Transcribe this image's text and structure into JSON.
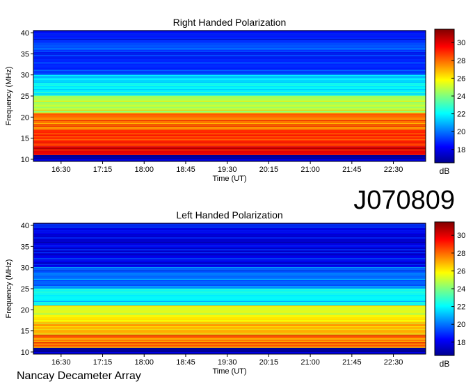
{
  "observation_id": "J070809",
  "footer_label": "Nancay Decameter Array",
  "chart_data": [
    {
      "type": "heatmap",
      "title": "Right Handed Polarization",
      "xlabel": "Time (UT)",
      "ylabel": "Frequency (MHz)",
      "x_ticks": [
        "16:30",
        "17:15",
        "18:00",
        "18:45",
        "19:30",
        "20:15",
        "21:00",
        "21:45",
        "22:30"
      ],
      "x_range": [
        "16:00",
        "23:05"
      ],
      "ylim": [
        9.5,
        40.5
      ],
      "y_ticks": [
        10,
        15,
        20,
        25,
        30,
        35,
        40
      ],
      "colorbar": {
        "label": "dB",
        "range": [
          16.5,
          31.5
        ],
        "ticks": [
          18,
          20,
          22,
          24,
          26,
          28,
          30
        ]
      },
      "intensity_bands": [
        {
          "freq_range_mhz": [
            10,
            11
          ],
          "db": 17
        },
        {
          "freq_range_mhz": [
            11,
            13
          ],
          "db": 30
        },
        {
          "freq_range_mhz": [
            13,
            17
          ],
          "db": 29
        },
        {
          "freq_range_mhz": [
            17,
            21
          ],
          "db": 28
        },
        {
          "freq_range_mhz": [
            21,
            25
          ],
          "db": 25
        },
        {
          "freq_range_mhz": [
            25,
            30
          ],
          "db": 22
        },
        {
          "freq_range_mhz": [
            30,
            40
          ],
          "db": 19
        }
      ]
    },
    {
      "type": "heatmap",
      "title": "Left Handed Polarization",
      "xlabel": "Time (UT)",
      "ylabel": "Frequency (MHz)",
      "x_ticks": [
        "16:30",
        "17:15",
        "18:00",
        "18:45",
        "19:30",
        "20:15",
        "21:00",
        "21:45",
        "22:30"
      ],
      "x_range": [
        "16:00",
        "23:05"
      ],
      "ylim": [
        9.5,
        40.5
      ],
      "y_ticks": [
        10,
        15,
        20,
        25,
        30,
        35,
        40
      ],
      "colorbar": {
        "label": "dB",
        "range": [
          16.5,
          31.5
        ],
        "ticks": [
          18,
          20,
          22,
          24,
          26,
          28,
          30
        ]
      },
      "intensity_bands": [
        {
          "freq_range_mhz": [
            10,
            11
          ],
          "db": 17
        },
        {
          "freq_range_mhz": [
            11,
            14
          ],
          "db": 28
        },
        {
          "freq_range_mhz": [
            14,
            17
          ],
          "db": 27
        },
        {
          "freq_range_mhz": [
            17,
            21
          ],
          "db": 26
        },
        {
          "freq_range_mhz": [
            21,
            25
          ],
          "db": 22
        },
        {
          "freq_range_mhz": [
            25,
            30
          ],
          "db": 20
        },
        {
          "freq_range_mhz": [
            30,
            40
          ],
          "db": 18
        }
      ]
    }
  ]
}
